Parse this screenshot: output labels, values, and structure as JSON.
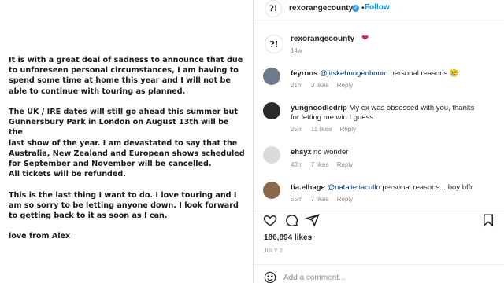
{
  "post": {
    "paragraphs": [
      "It is with a great deal of sadness to announce that due\nto unforeseen personal circumstances, I am having to\nspend some time at home this year and I will not be\nable to continue with touring as planned.",
      "The UK / IRE dates will still go ahead this summer but\nGunnersbury Park in London on August 13th will be the\nlast show of the year. I am devastated to say that the\nAustralia, New Zealand and European shows scheduled\nfor September and November will be cancelled.\nAll tickets will be refunded.",
      "This is the last thing I want to do. I love touring and I\nam so sorry to be letting anyone down. I look forward\nto getting back to it as soon as I can.",
      "love from Alex"
    ]
  },
  "header": {
    "avatar_glyph": "?!",
    "username": "rexorangecounty",
    "verified_mark": "✓",
    "separator": "•",
    "follow_label": "Follow"
  },
  "caption": {
    "avatar_glyph": "?!",
    "username": "rexorangecounty",
    "emoji": "❤",
    "time": "14w"
  },
  "comments": [
    {
      "username": "feyroos",
      "mention": "@jitskehoogenboom",
      "text": " personal reasons 😢",
      "time": "21m",
      "likes": "3 likes",
      "reply": "Reply",
      "avatar_color": "#6b7b8c"
    },
    {
      "username": "yungnoodledrip",
      "mention": "",
      "text": " My ex was obsessed with you, thanks for letting me win I guess",
      "time": "25m",
      "likes": "11 likes",
      "reply": "Reply",
      "avatar_color": "#2a2a2a"
    },
    {
      "username": "ehsyz",
      "mention": "",
      "text": " no wonder",
      "time": "43m",
      "likes": "7 likes",
      "reply": "Reply",
      "avatar_color": "#dbdbdb"
    },
    {
      "username": "tia.elhage",
      "mention": "@natalie.iacullo",
      "text": " personal reasons... boy bffr",
      "time": "55m",
      "likes": "7 likes",
      "reply": "Reply",
      "avatar_color": "#8a6a4a"
    }
  ],
  "actions": {
    "icons": [
      "heart-icon",
      "comment-icon",
      "share-icon",
      "bookmark-icon"
    ]
  },
  "likes_count": "186,894 likes",
  "post_date": "JULY 2",
  "add_comment": {
    "placeholder": "Add a comment...",
    "emoji_icon": "smiley-icon"
  },
  "colors": {
    "accent": "#0095f6",
    "verified": "#3897f0",
    "heart": "#e0245e",
    "muted": "#8e8e8e"
  }
}
